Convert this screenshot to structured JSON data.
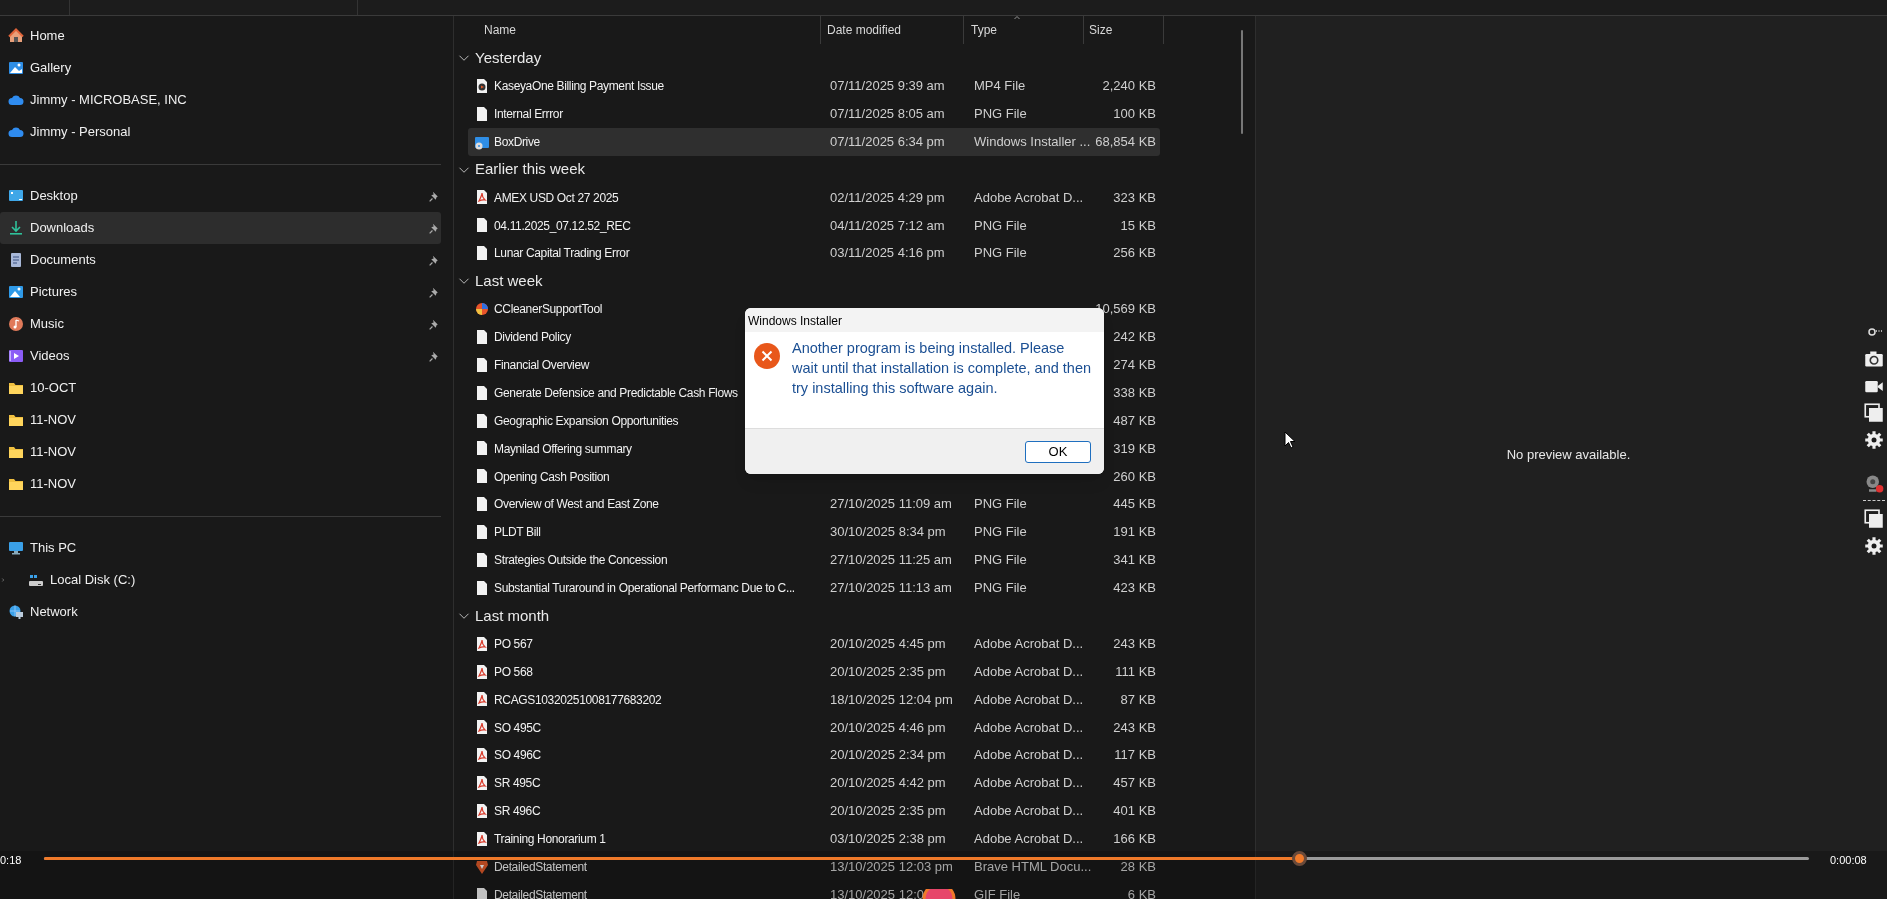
{
  "sidebar": {
    "sections": [
      [
        {
          "label": "Home",
          "kind": "home",
          "pinned": false,
          "selected": false
        },
        {
          "label": "Gallery",
          "kind": "gallery",
          "pinned": false,
          "selected": false
        },
        {
          "label": "Jimmy - MICROBASE, INC",
          "kind": "cloud",
          "pinned": false,
          "selected": false
        },
        {
          "label": "Jimmy - Personal",
          "kind": "cloud",
          "pinned": false,
          "selected": false
        }
      ],
      [
        {
          "label": "Desktop",
          "kind": "desktop",
          "pinned": true,
          "selected": false
        },
        {
          "label": "Downloads",
          "kind": "downloads",
          "pinned": true,
          "selected": true
        },
        {
          "label": "Documents",
          "kind": "documents",
          "pinned": true,
          "selected": false
        },
        {
          "label": "Pictures",
          "kind": "pictures",
          "pinned": true,
          "selected": false
        },
        {
          "label": "Music",
          "kind": "music",
          "pinned": true,
          "selected": false
        },
        {
          "label": "Videos",
          "kind": "videos",
          "pinned": true,
          "selected": false
        },
        {
          "label": "10-OCT",
          "kind": "folder",
          "pinned": false,
          "selected": false
        },
        {
          "label": "11-NOV",
          "kind": "folder",
          "pinned": false,
          "selected": false
        },
        {
          "label": "11-NOV",
          "kind": "folder",
          "pinned": false,
          "selected": false
        },
        {
          "label": "11-NOV",
          "kind": "folder",
          "pinned": false,
          "selected": false
        }
      ],
      [
        {
          "label": "This PC",
          "kind": "pc",
          "pinned": false,
          "selected": false,
          "children": [
            {
              "label": "Local Disk (C:)",
              "kind": "disk",
              "pinned": false,
              "selected": false,
              "expanded": false
            }
          ]
        },
        {
          "label": "Network",
          "kind": "network",
          "pinned": false,
          "selected": false
        }
      ]
    ]
  },
  "file_list": {
    "columns": [
      {
        "label": "Name",
        "sorted": false
      },
      {
        "label": "Date modified",
        "sorted": false
      },
      {
        "label": "Type",
        "sorted": true
      },
      {
        "label": "Size",
        "sorted": false
      }
    ],
    "groups": [
      {
        "label": "Yesterday",
        "expanded": true,
        "rows": [
          {
            "name": "KaseyaOne Billing Payment Issue",
            "date": "07/11/2025 9:39 am",
            "type": "MP4 File",
            "size": "2,240 KB",
            "kind": "video",
            "selected": false
          },
          {
            "name": "Internal Errror",
            "date": "07/11/2025 8:05 am",
            "type": "PNG File",
            "size": "100 KB",
            "kind": "image",
            "selected": false
          },
          {
            "name": "BoxDrive",
            "date": "07/11/2025 6:34 pm",
            "type": "Windows Installer ...",
            "size": "68,854 KB",
            "kind": "installer",
            "selected": true
          }
        ]
      },
      {
        "label": "Earlier this week",
        "expanded": true,
        "rows": [
          {
            "name": "AMEX USD Oct 27 2025",
            "date": "02/11/2025 4:29 pm",
            "type": "Adobe Acrobat D...",
            "size": "323 KB",
            "kind": "pdf",
            "selected": false
          },
          {
            "name": "04.11.2025_07.12.52_REC",
            "date": "04/11/2025 7:12 am",
            "type": "PNG File",
            "size": "15 KB",
            "kind": "image",
            "selected": false
          },
          {
            "name": "Lunar Capital Trading Error",
            "date": "03/11/2025 4:16 pm",
            "type": "PNG File",
            "size": "256 KB",
            "kind": "image",
            "selected": false
          }
        ]
      },
      {
        "label": "Last week",
        "expanded": true,
        "rows": [
          {
            "name": "CCleanerSupportTool",
            "size": "10,569 KB",
            "kind": "app",
            "selected": false
          },
          {
            "name": "Dividend Policy",
            "size": "242 KB",
            "kind": "image",
            "selected": false
          },
          {
            "name": "Financial Overview",
            "size": "274 KB",
            "kind": "image",
            "selected": false
          },
          {
            "name": "Generate Defensice and Predictable Cash Flows",
            "size": "338 KB",
            "kind": "image",
            "selected": false
          },
          {
            "name": "Geographic Expansion Opportunities",
            "size": "487 KB",
            "kind": "image",
            "selected": false
          },
          {
            "name": "Maynilad Offering summary",
            "size": "319 KB",
            "kind": "image",
            "selected": false
          },
          {
            "name": "Opening Cash Position",
            "size": "260 KB",
            "kind": "image",
            "selected": false
          },
          {
            "name": "Overview of West and East Zone",
            "date": "27/10/2025 11:09 am",
            "type": "PNG File",
            "size": "445 KB",
            "kind": "image",
            "selected": false
          },
          {
            "name": "PLDT Bill",
            "date": "30/10/2025 8:34 pm",
            "type": "PNG File",
            "size": "191 KB",
            "kind": "image",
            "selected": false
          },
          {
            "name": "Strategies Outside the Concession",
            "date": "27/10/2025 11:25 am",
            "type": "PNG File",
            "size": "341 KB",
            "kind": "image",
            "selected": false
          },
          {
            "name": "Substantial Turaround in Operational Performanc Due to C...",
            "date": "27/10/2025 11:13 am",
            "type": "PNG File",
            "size": "423 KB",
            "kind": "image",
            "selected": false
          }
        ]
      },
      {
        "label": "Last month",
        "expanded": true,
        "rows": [
          {
            "name": "PO 567",
            "date": "20/10/2025 4:45 pm",
            "type": "Adobe Acrobat D...",
            "size": "243 KB",
            "kind": "pdf",
            "selected": false
          },
          {
            "name": "PO 568",
            "date": "20/10/2025 2:35 pm",
            "type": "Adobe Acrobat D...",
            "size": "111 KB",
            "kind": "pdf",
            "selected": false
          },
          {
            "name": "RCAGS10320251008177683202",
            "date": "18/10/2025 12:04 pm",
            "type": "Adobe Acrobat D...",
            "size": "87 KB",
            "kind": "pdf",
            "selected": false
          },
          {
            "name": "SO 495C",
            "date": "20/10/2025 4:46 pm",
            "type": "Adobe Acrobat D...",
            "size": "243 KB",
            "kind": "pdf",
            "selected": false
          },
          {
            "name": "SO 496C",
            "date": "20/10/2025 2:34 pm",
            "type": "Adobe Acrobat D...",
            "size": "117 KB",
            "kind": "pdf",
            "selected": false
          },
          {
            "name": "SR 495C",
            "date": "20/10/2025 4:42 pm",
            "type": "Adobe Acrobat D...",
            "size": "457 KB",
            "kind": "pdf",
            "selected": false
          },
          {
            "name": "SR 496C",
            "date": "20/10/2025 2:35 pm",
            "type": "Adobe Acrobat D...",
            "size": "401 KB",
            "kind": "pdf",
            "selected": false
          },
          {
            "name": "Training Honorarium 1",
            "date": "03/10/2025 2:38 pm",
            "type": "Adobe Acrobat D...",
            "size": "166 KB",
            "kind": "pdf",
            "selected": false
          },
          {
            "name": "DetailedStatement",
            "date": "13/10/2025 12:03 pm",
            "type": "Brave HTML Docu...",
            "size": "28 KB",
            "kind": "html",
            "selected": false
          },
          {
            "name": "DetailedStatement",
            "date": "13/10/2025 12:0",
            "type": "GIF File",
            "size": "6 KB",
            "kind": "image",
            "selected": false
          }
        ]
      }
    ]
  },
  "preview": {
    "message": "No preview available."
  },
  "dialog": {
    "title": "Windows Installer",
    "message": "Another program is being installed. Please wait until that installation is complete, and then try installing this software again.",
    "buttons": [
      "OK"
    ]
  },
  "player": {
    "elapsed": "0:18",
    "remaining": "0:00:08",
    "level": 0.711
  }
}
